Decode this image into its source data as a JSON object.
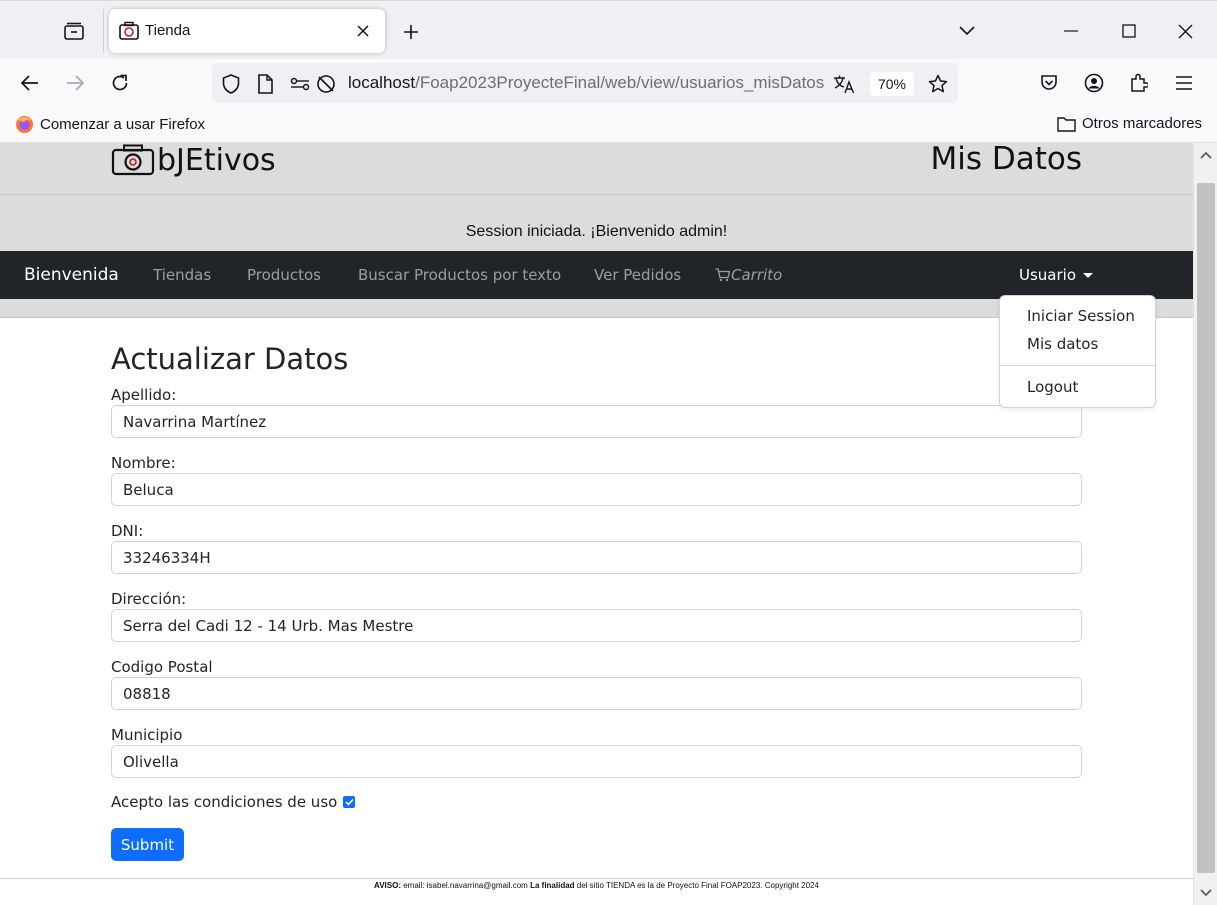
{
  "browser": {
    "tab": {
      "title": "Tienda"
    },
    "url": {
      "host": "localhost",
      "path": "/Foap2023ProyecteFinal/web/view/usuarios_misDatos"
    },
    "zoom": "70%",
    "bookmarks": {
      "get_started": "Comenzar a usar Firefox",
      "other": "Otros marcadores"
    }
  },
  "site": {
    "logo_text": "bJEtivos",
    "page_heading": "Mis Datos",
    "session_message": "Session iniciada. ¡Bienvenido admin!"
  },
  "nav": {
    "brand": "Bienvenida",
    "links": [
      "Tiendas",
      "Productos",
      "Buscar Productos por texto",
      "Ver Pedidos"
    ],
    "cart": "Carrito",
    "user_menu": {
      "label": "Usuario",
      "items": [
        "Iniciar Session",
        "Mis datos",
        "Logout"
      ]
    }
  },
  "form": {
    "title": "Actualizar Datos",
    "fields": [
      {
        "label": "Apellido:",
        "value": "Navarrina Martínez"
      },
      {
        "label": "Nombre:",
        "value": "Beluca"
      },
      {
        "label": "DNI:",
        "value": "33246334H"
      },
      {
        "label": "Dirección:",
        "value": "Serra del Cadi 12 - 14 Urb. Mas Mestre"
      },
      {
        "label": "Codigo Postal",
        "value": "08818"
      },
      {
        "label": "Municipio",
        "value": "Olivella"
      }
    ],
    "terms_label": "Acepto las condiciones de uso",
    "terms_checked": true,
    "submit_label": "Submit"
  },
  "footer": {
    "aviso_label": "AVISO:",
    "email_text": "email: isabel.navarrina@gmail.com",
    "la": "La",
    "finalidad": "finalidad",
    "rest": "del sitio TIENDA es la de Proyecto Final FOAP2023. Copyright 2024"
  },
  "colors": {
    "accent": "#0d6efd",
    "navbar": "#212529",
    "header_gray": "#dcdcdc"
  }
}
